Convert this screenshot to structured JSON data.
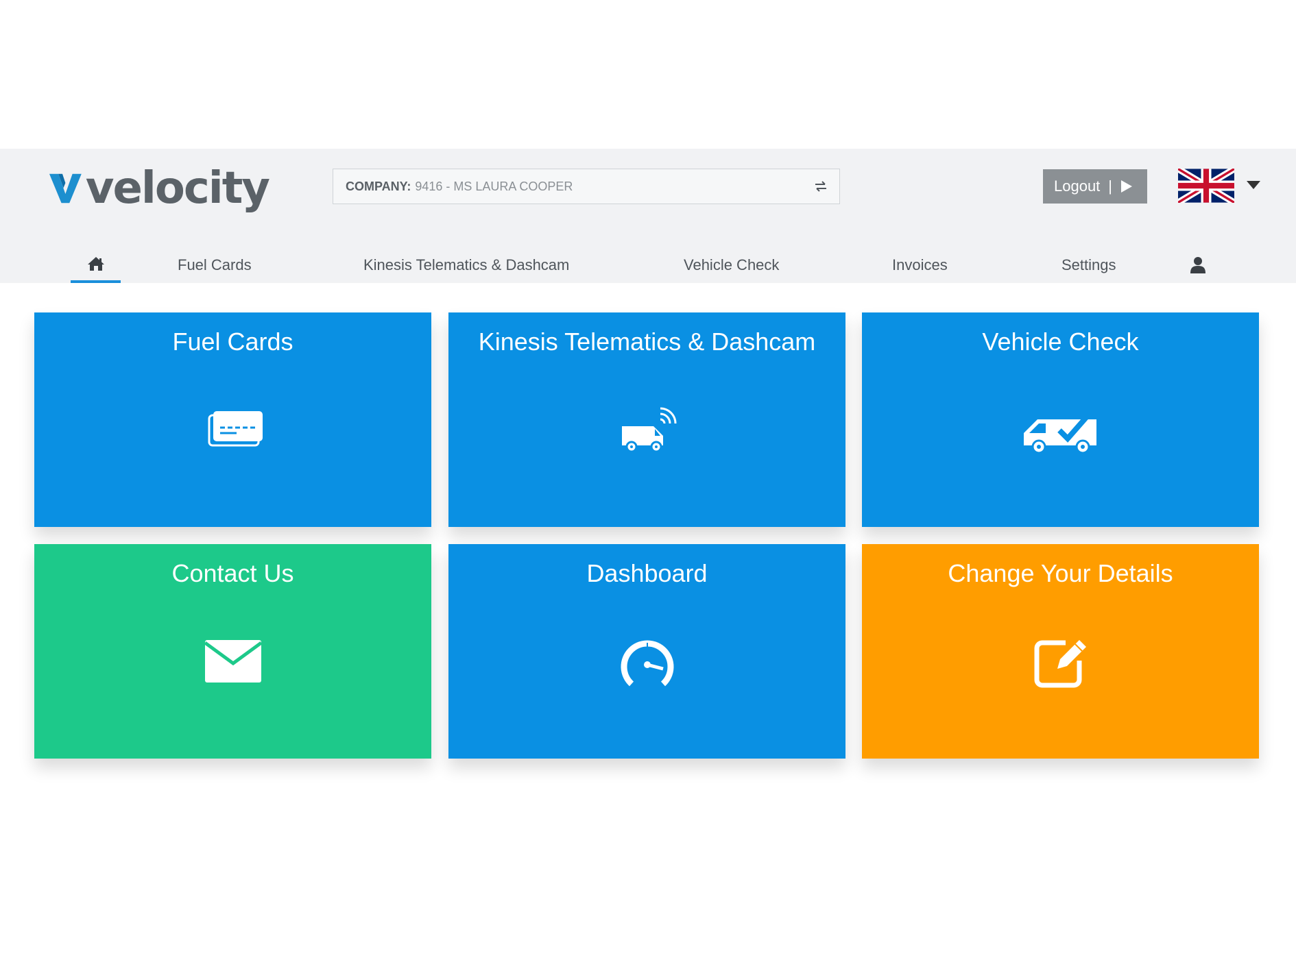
{
  "header": {
    "logo_text": "velocity",
    "company_label": "COMPANY:",
    "company_value": "9416 - MS LAURA COOPER",
    "logout_label": "Logout",
    "logout_separator": "|",
    "language_icon": "uk-flag-icon"
  },
  "nav": {
    "home_icon": "home-icon",
    "items": [
      {
        "label": "Fuel Cards"
      },
      {
        "label": "Kinesis Telematics & Dashcam"
      },
      {
        "label": "Vehicle Check"
      },
      {
        "label": "Invoices"
      },
      {
        "label": "Settings"
      }
    ],
    "user_icon": "user-icon"
  },
  "tiles": [
    {
      "title": "Fuel Cards",
      "icon": "card-stack-icon",
      "color": "#0a90e3"
    },
    {
      "title": "Kinesis Telematics & Dashcam",
      "icon": "van-signal-icon",
      "color": "#0a90e3"
    },
    {
      "title": "Vehicle Check",
      "icon": "van-check-icon",
      "color": "#0a90e3"
    },
    {
      "title": "Contact Us",
      "icon": "envelope-icon",
      "color": "#1dc98a"
    },
    {
      "title": "Dashboard",
      "icon": "speedometer-icon",
      "color": "#0a90e3"
    },
    {
      "title": "Change Your Details",
      "icon": "edit-icon",
      "color": "#ff9d00"
    }
  ],
  "colors": {
    "header_bg": "#f1f2f4",
    "accent": "#1a8fdb",
    "logout_bg": "#8b9094",
    "logo_mark": "#1d8fcf"
  }
}
